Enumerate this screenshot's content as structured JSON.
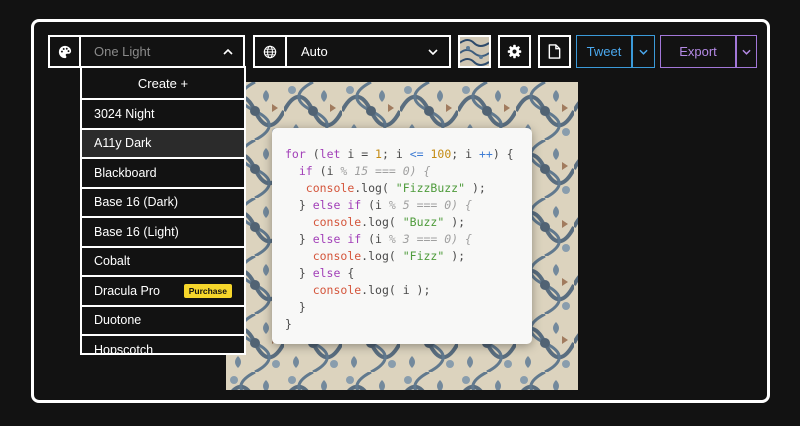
{
  "toolbar": {
    "theme_icon": "palette-icon",
    "theme_value": "One Light",
    "language_icon": "globe-icon",
    "language_value": "Auto",
    "settings_icon": "gear-icon",
    "copy_icon": "document-icon",
    "tweet_label": "Tweet",
    "export_label": "Export"
  },
  "colors": {
    "tweet_accent": "#3b9ad9",
    "export_accent": "#a277d8",
    "badge": "#f6d62b"
  },
  "theme_menu": {
    "create_label": "Create +",
    "items": [
      {
        "label": "3024 Night"
      },
      {
        "label": "A11y Dark"
      },
      {
        "label": "Blackboard"
      },
      {
        "label": "Base 16 (Dark)"
      },
      {
        "label": "Base 16 (Light)"
      },
      {
        "label": "Cobalt"
      },
      {
        "label": "Dracula Pro",
        "badge": "Purchase"
      },
      {
        "label": "Duotone"
      },
      {
        "label": "Hopscotch"
      }
    ]
  },
  "code": {
    "lines": [
      [
        [
          "for",
          "kw"
        ],
        [
          " (",
          "p"
        ],
        [
          "let",
          "kw"
        ],
        [
          " i = ",
          "p"
        ],
        [
          "1",
          "num"
        ],
        [
          "; i ",
          "p"
        ],
        [
          "<=",
          "op"
        ],
        [
          " ",
          "p"
        ],
        [
          "100",
          "num"
        ],
        [
          "; i ",
          "p"
        ],
        [
          "++",
          "op"
        ],
        [
          ") {",
          "p"
        ]
      ],
      [
        [
          "  ",
          "p"
        ],
        [
          "if",
          "kw"
        ],
        [
          " (i ",
          "p"
        ],
        [
          "% 15 === 0) {",
          "cm"
        ]
      ],
      [
        [
          "   ",
          "p"
        ],
        [
          "console",
          "fn"
        ],
        [
          ".log( ",
          "p"
        ],
        [
          "\"FizzBuzz\"",
          "str"
        ],
        [
          " );",
          "p"
        ]
      ],
      [
        [
          "  } ",
          "p"
        ],
        [
          "else if",
          "kw"
        ],
        [
          " (i ",
          "p"
        ],
        [
          "% 5 === 0) {",
          "cm"
        ]
      ],
      [
        [
          "    ",
          "p"
        ],
        [
          "console",
          "fn"
        ],
        [
          ".log( ",
          "p"
        ],
        [
          "\"Buzz\"",
          "str"
        ],
        [
          " );",
          "p"
        ]
      ],
      [
        [
          "  } ",
          "p"
        ],
        [
          "else if",
          "kw"
        ],
        [
          " (i ",
          "p"
        ],
        [
          "% 3 === 0) {",
          "cm"
        ]
      ],
      [
        [
          "    ",
          "p"
        ],
        [
          "console",
          "fn"
        ],
        [
          ".log( ",
          "p"
        ],
        [
          "\"Fizz\"",
          "str"
        ],
        [
          " );",
          "p"
        ]
      ],
      [
        [
          "  } ",
          "p"
        ],
        [
          "else",
          "kw"
        ],
        [
          " {",
          "p"
        ]
      ],
      [
        [
          "    ",
          "p"
        ],
        [
          "console",
          "fn"
        ],
        [
          ".log( i );",
          "p"
        ]
      ],
      [
        [
          "  }",
          "p"
        ]
      ],
      [
        [
          "}",
          "p"
        ]
      ]
    ]
  }
}
